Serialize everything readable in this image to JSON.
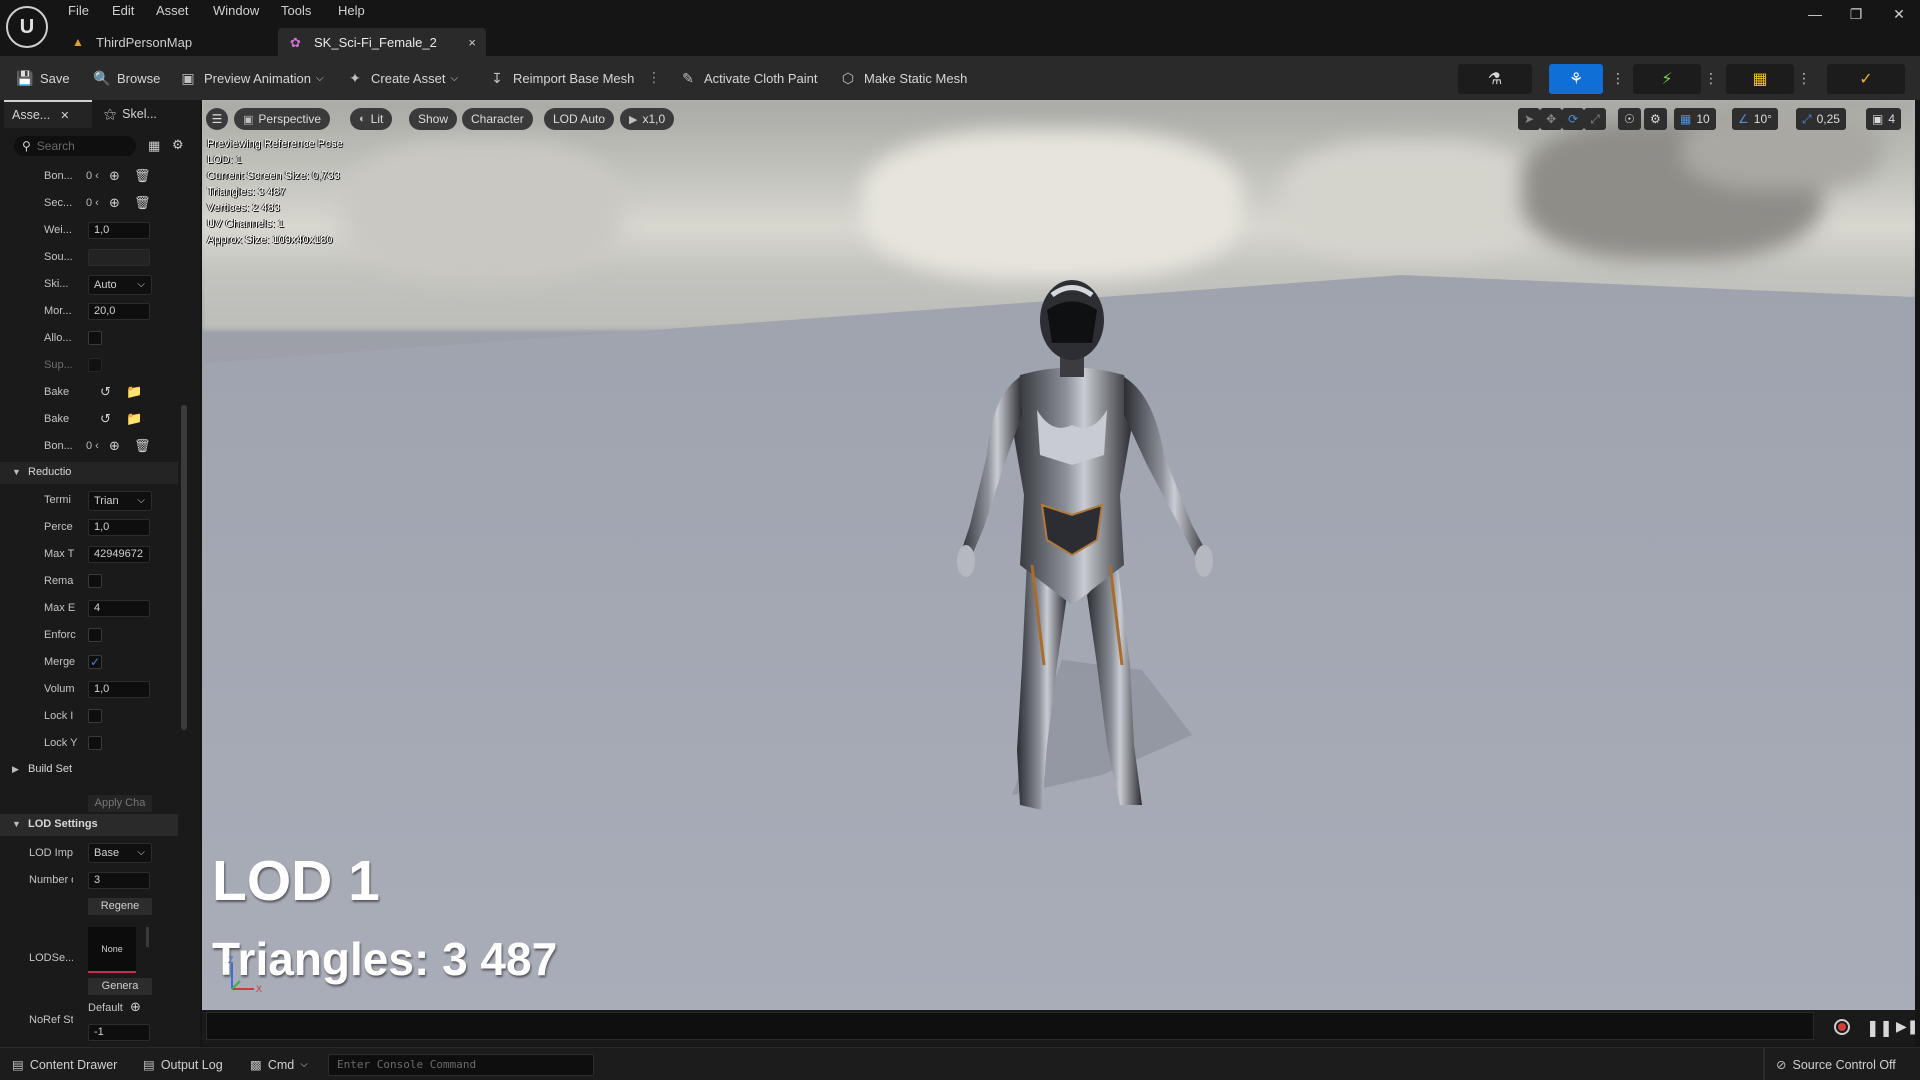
{
  "menu": [
    "File",
    "Edit",
    "Asset",
    "Window",
    "Tools",
    "Help"
  ],
  "tabs": [
    {
      "label": "ThirdPersonMap"
    },
    {
      "label": "SK_Sci-Fi_Female_2",
      "close": "×"
    }
  ],
  "toolbar": {
    "save": "Save",
    "browse": "Browse",
    "preview_animation": "Preview Animation",
    "create_asset": "Create Asset",
    "reimport": "Reimport Base Mesh",
    "cloth_paint": "Activate Cloth Paint",
    "static_mesh": "Make Static Mesh"
  },
  "panel": {
    "tab_asset": "Asse...",
    "tab_skel": "Skel...",
    "search_placeholder": "Search",
    "rows": {
      "bon1": "Bon...",
      "sec": "Sec...",
      "wei": "Wei...",
      "wei_val": "1,0",
      "sou": "Sou...",
      "ski": "Ski...",
      "ski_val": "Auto",
      "mor": "Mor...",
      "mor_val": "20,0",
      "allo": "Allo...",
      "sup": "Sup...",
      "bake1": "Bake",
      "bake2": "Bake",
      "bon2": "Bon...",
      "count_mark": "0 ‹"
    },
    "reduction": {
      "section": "Reductio",
      "termi": "Termi",
      "termi_val": "Trian",
      "perce": "Perce",
      "perce_val": "1,0",
      "maxt": "Max T",
      "maxt_val": "42949672",
      "rema": "Rema",
      "maxe": "Max E",
      "maxe_val": "4",
      "enforc": "Enforc",
      "merge": "Merge",
      "volum": "Volum",
      "volum_val": "1,0",
      "lock1": "Lock I",
      "lock2": "Lock Y"
    },
    "build_section": "Build Set",
    "apply_btn": "Apply Cha",
    "lod_settings": {
      "section": "LOD Settings",
      "import": "LOD Impo",
      "import_val": "Base",
      "number": "Number o",
      "number_val": "3",
      "regen": "Regenе",
      "lodse": "LODSe...",
      "thumb": "None",
      "genera": "Genera",
      "noref": "NoRef St",
      "default": "Default",
      "noref_val": "-1"
    }
  },
  "viewport": {
    "perspective": "Perspective",
    "lit": "Lit",
    "show": "Show",
    "character": "Character",
    "lod_auto": "LOD Auto",
    "speed": "x1,0",
    "grid": "10",
    "angle": "10°",
    "scale": "0,25",
    "camera": "4",
    "stats": [
      "Previewing Reference Pose",
      "LOD: 1",
      "Current Screen Size: 0,733",
      "Triangles: 3 487",
      "Vertices: 2 483",
      "UV Channels: 1",
      "Approx Size: 109x40x180"
    ],
    "big_lod": "LOD 1",
    "big_triangles": "Triangles: 3 487",
    "axis_z": "Z",
    "axis_x": "X"
  },
  "statusbar": {
    "content_drawer": "Content Drawer",
    "output_log": "Output Log",
    "cmd": "Cmd",
    "console_placeholder": "Enter Console Command",
    "source_control": "Source Control Off"
  },
  "colors": {
    "accent": "#0f6fd6",
    "record": "#d2403c"
  }
}
